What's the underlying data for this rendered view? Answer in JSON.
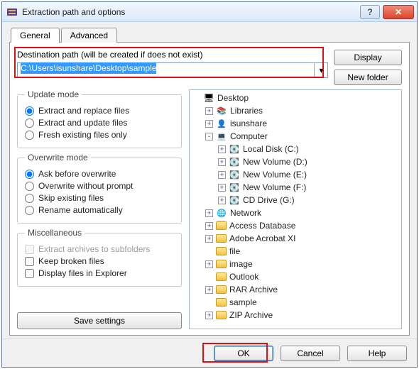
{
  "window": {
    "title": "Extraction path and options",
    "help_glyph": "?",
    "close_glyph": "✕"
  },
  "tabs": {
    "general": "General",
    "advanced": "Advanced"
  },
  "dest": {
    "label": "Destination path (will be created if does not exist)",
    "value": "C:\\Users\\isunshare\\Desktop\\sample",
    "dropdown_glyph": "▾"
  },
  "side_buttons": {
    "display": "Display",
    "new_folder": "New folder"
  },
  "update_mode": {
    "legend": "Update mode",
    "options": [
      {
        "label": "Extract and replace files",
        "checked": true
      },
      {
        "label": "Extract and update files",
        "checked": false
      },
      {
        "label": "Fresh existing files only",
        "checked": false
      }
    ]
  },
  "overwrite_mode": {
    "legend": "Overwrite mode",
    "options": [
      {
        "label": "Ask before overwrite",
        "checked": true
      },
      {
        "label": "Overwrite without prompt",
        "checked": false
      },
      {
        "label": "Skip existing files",
        "checked": false
      },
      {
        "label": "Rename automatically",
        "checked": false
      }
    ]
  },
  "misc": {
    "legend": "Miscellaneous",
    "options": [
      {
        "label": "Extract archives to subfolders",
        "disabled": true
      },
      {
        "label": "Keep broken files",
        "disabled": false
      },
      {
        "label": "Display files in Explorer",
        "disabled": false
      }
    ]
  },
  "save_settings": "Save settings",
  "tree": [
    {
      "indent": 0,
      "pm": "",
      "icon": "desktop",
      "label": "Desktop"
    },
    {
      "indent": 1,
      "pm": "+",
      "icon": "lib",
      "label": "Libraries"
    },
    {
      "indent": 1,
      "pm": "+",
      "icon": "user",
      "label": "isunshare"
    },
    {
      "indent": 1,
      "pm": "-",
      "icon": "comp",
      "label": "Computer"
    },
    {
      "indent": 2,
      "pm": "+",
      "icon": "disk",
      "label": "Local Disk (C:)"
    },
    {
      "indent": 2,
      "pm": "+",
      "icon": "disk",
      "label": "New Volume (D:)"
    },
    {
      "indent": 2,
      "pm": "+",
      "icon": "disk",
      "label": "New Volume (E:)"
    },
    {
      "indent": 2,
      "pm": "+",
      "icon": "disk",
      "label": "New Volume (F:)"
    },
    {
      "indent": 2,
      "pm": "+",
      "icon": "disk",
      "label": "CD Drive (G:)"
    },
    {
      "indent": 1,
      "pm": "+",
      "icon": "net",
      "label": "Network"
    },
    {
      "indent": 1,
      "pm": "+",
      "icon": "folder",
      "label": "Access Database"
    },
    {
      "indent": 1,
      "pm": "+",
      "icon": "folder",
      "label": "Adobe Acrobat XI"
    },
    {
      "indent": 1,
      "pm": "",
      "icon": "folder",
      "label": "file"
    },
    {
      "indent": 1,
      "pm": "+",
      "icon": "folder",
      "label": "image"
    },
    {
      "indent": 1,
      "pm": "",
      "icon": "folder",
      "label": "Outlook"
    },
    {
      "indent": 1,
      "pm": "+",
      "icon": "folder",
      "label": "RAR Archive"
    },
    {
      "indent": 1,
      "pm": "",
      "icon": "folder",
      "label": "sample"
    },
    {
      "indent": 1,
      "pm": "+",
      "icon": "folder",
      "label": "ZIP Archive"
    }
  ],
  "footer": {
    "ok": "OK",
    "cancel": "Cancel",
    "help": "Help"
  }
}
